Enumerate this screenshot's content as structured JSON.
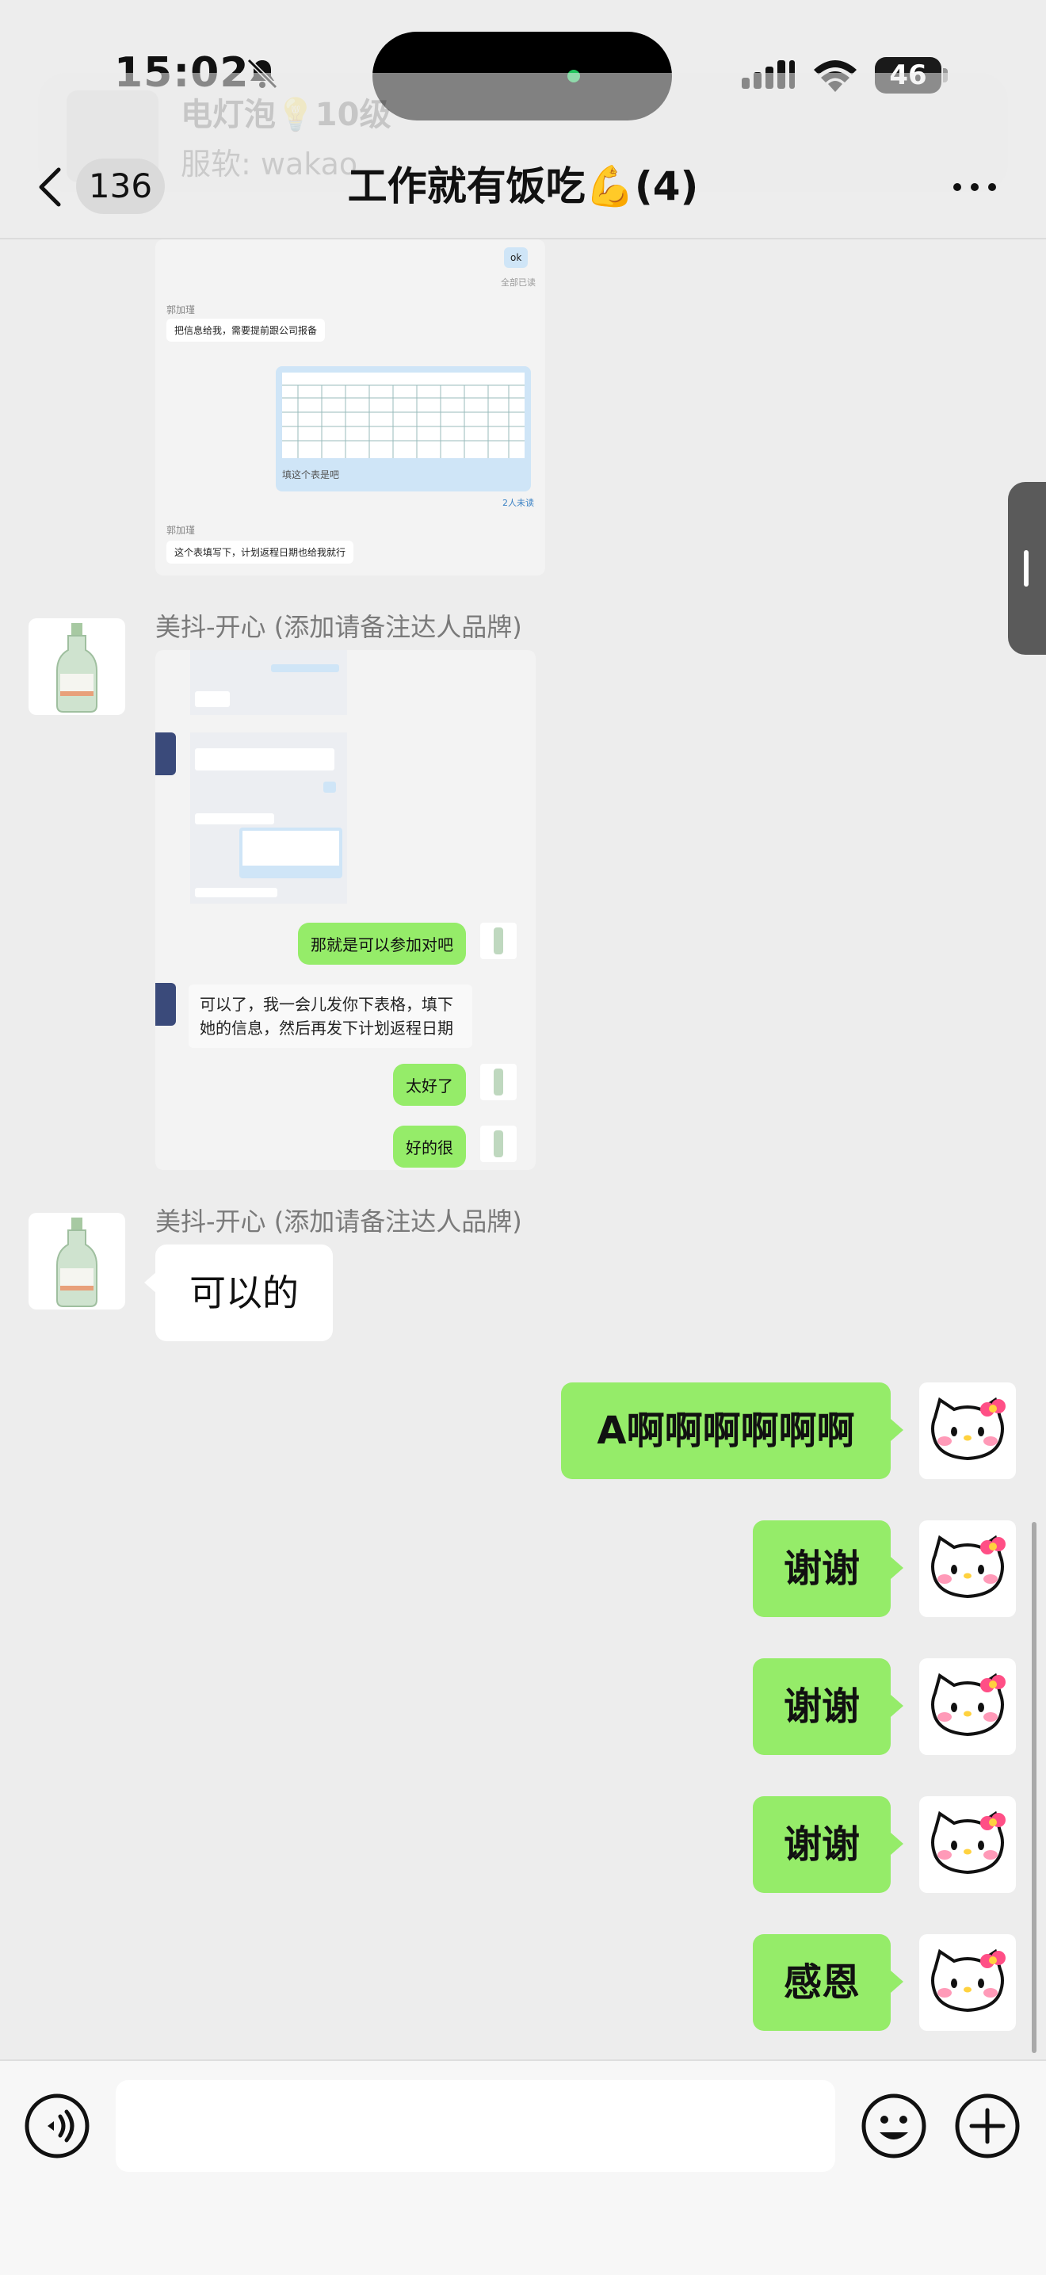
{
  "status": {
    "time": "15:02",
    "battery": "46"
  },
  "ghost_notification": {
    "title": "电灯泡💡10级",
    "subtitle": "服软: wakao"
  },
  "nav": {
    "unread_count": "136",
    "title": "工作就有饭吃💪(4)"
  },
  "screenshot1": {
    "ok_text": "ok",
    "read_text": "全部已读",
    "sender": "郭加瑾",
    "msg1": "把信息给我，需要提前跟公司报备",
    "table_caption": "填这个表是吧",
    "unread_text": "2人未读",
    "sender2": "郭加瑾",
    "msg2": "这个表填写下，计划返程日期也给我就行"
  },
  "messages": {
    "m1_sender": "美抖-开心 (添加请备注达人品牌)",
    "m2_sender": "美抖-开心 (添加请备注达人品牌)",
    "m2_text": "可以的",
    "m3_text": "A啊啊啊啊啊啊",
    "m4_text": "谢谢",
    "m5_text": "谢谢",
    "m6_text": "谢谢",
    "m7_text": "感恩"
  },
  "screenshot2": {
    "green1": "那就是可以参加对吧",
    "white1": "可以了，我一会儿发你下表格，填下她的信息，然后再发下计划返程日期",
    "green2": "太好了",
    "green3": "好的很"
  }
}
